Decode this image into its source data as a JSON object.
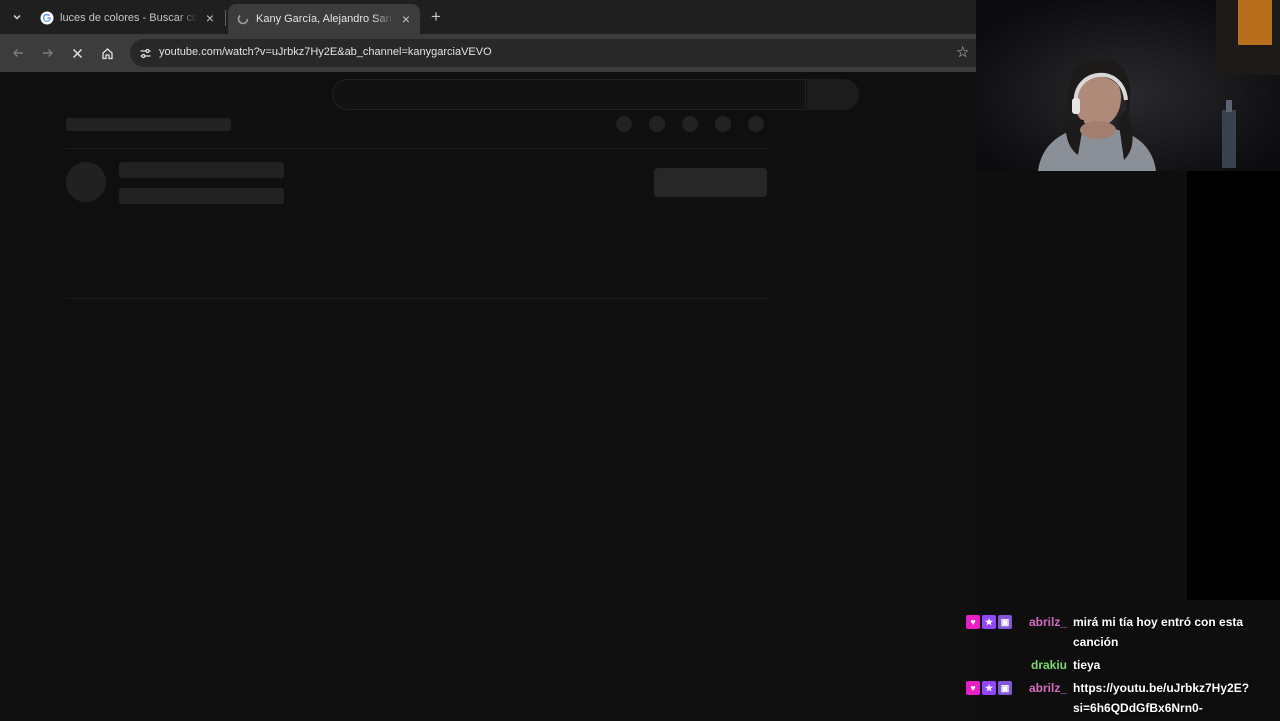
{
  "browser": {
    "tabs": [
      {
        "title": "luces de colores - Buscar con Google",
        "active": false,
        "favicon": "google-icon"
      },
      {
        "title": "Kany García, Alejandro Sanz - Muéstrame",
        "active": true,
        "favicon": "loading-icon"
      }
    ],
    "url": "youtube.com/watch?v=uJrbkz7Hy2E&ab_channel=kanygarciaVEVO"
  },
  "chat": {
    "messages": [
      {
        "user": "abrilz_",
        "user_color": "#d66cc0",
        "badges": true,
        "text": "mirá mi tía hoy entró con esta canción"
      },
      {
        "user": "drakiu",
        "user_color": "#7bd96b",
        "badges": false,
        "text": "tieya"
      },
      {
        "user": "abrilz_",
        "user_color": "#d66cc0",
        "badges": true,
        "text": "https://youtu.be/uJrbkz7Hy2E?si=6h6QDdGfBx6Nrn0-"
      }
    ]
  },
  "colors": {
    "page_bg": "#0f0f0f",
    "tab_strip": "#1f1f1f",
    "toolbar": "#3c3c3c",
    "badge_heart": "#e91ec5",
    "badge_star": "#9146ff",
    "badge_sub": "#8257d8"
  }
}
